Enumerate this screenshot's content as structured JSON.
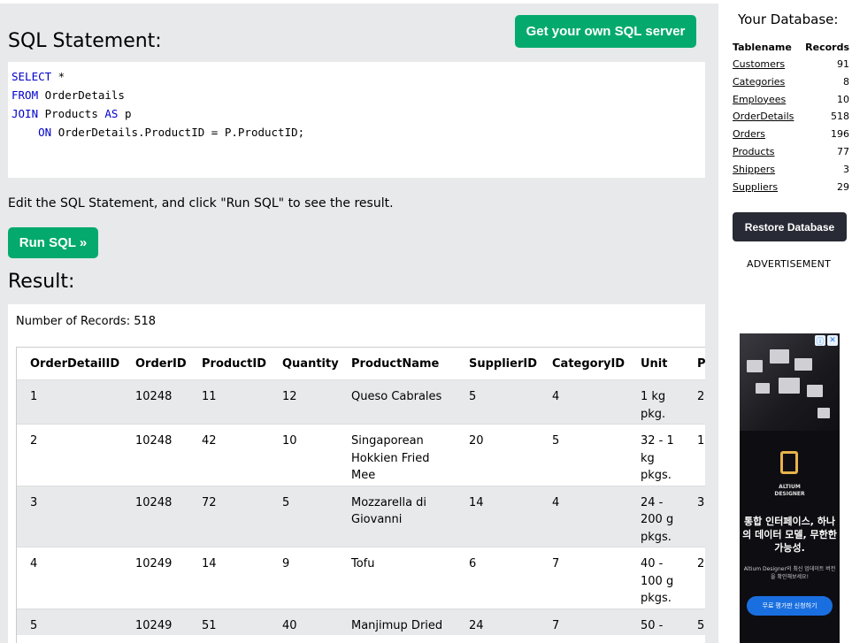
{
  "sql_panel": {
    "title": "SQL Statement:",
    "get_server_label": "Get your own SQL server",
    "code_lines": [
      {
        "kw": "SELECT",
        "rest": " *"
      },
      {
        "kw": "FROM",
        "rest": " OrderDetails"
      },
      {
        "kw": "JOIN",
        "rest": " Products ",
        "kw2": "AS",
        "rest2": " p"
      },
      {
        "indent": "    ",
        "kw": "ON",
        "rest": " OrderDetails.ProductID = P.ProductID;"
      }
    ],
    "instructions": "Edit the SQL Statement, and click \"Run SQL\" to see the result.",
    "run_label": "Run SQL »"
  },
  "result": {
    "title": "Result:",
    "count_text": "Number of Records: 518",
    "headers": [
      "OrderDetailID",
      "OrderID",
      "ProductID",
      "Quantity",
      "ProductName",
      "SupplierID",
      "CategoryID",
      "Unit",
      "P"
    ],
    "rows": [
      [
        "1",
        "10248",
        "11",
        "12",
        "Queso Cabrales",
        "5",
        "4",
        "1 kg pkg.",
        "2"
      ],
      [
        "2",
        "10248",
        "42",
        "10",
        "Singaporean Hokkien Fried Mee",
        "20",
        "5",
        "32 - 1 kg pkgs.",
        "1"
      ],
      [
        "3",
        "10248",
        "72",
        "5",
        "Mozzarella di Giovanni",
        "14",
        "4",
        "24 - 200 g pkgs.",
        "3"
      ],
      [
        "4",
        "10249",
        "14",
        "9",
        "Tofu",
        "6",
        "7",
        "40 - 100 g pkgs.",
        "2"
      ],
      [
        "5",
        "10249",
        "51",
        "40",
        "Manjimup Dried",
        "24",
        "7",
        "50 -",
        "5"
      ]
    ]
  },
  "sidebar": {
    "title": "Your Database:",
    "headers": [
      "Tablename",
      "Records"
    ],
    "tables": [
      {
        "name": "Customers",
        "records": "91"
      },
      {
        "name": "Categories",
        "records": "8"
      },
      {
        "name": "Employees",
        "records": "10"
      },
      {
        "name": "OrderDetails",
        "records": "518"
      },
      {
        "name": "Orders",
        "records": "196"
      },
      {
        "name": "Products",
        "records": "77"
      },
      {
        "name": "Shippers",
        "records": "3"
      },
      {
        "name": "Suppliers",
        "records": "29"
      }
    ],
    "restore_label": "Restore Database",
    "ad_label": "ADVERTISEMENT"
  },
  "ad": {
    "brand": "ALTIUM\nDESIGNER",
    "headline": "통합 인터페이스, 하나의 데이터 모델, 무한한 가능성.",
    "sub": "Altium Designer의 최신 업데이트 버전을 확인해보세요!",
    "cta": "무료 평가판 신청하기"
  }
}
